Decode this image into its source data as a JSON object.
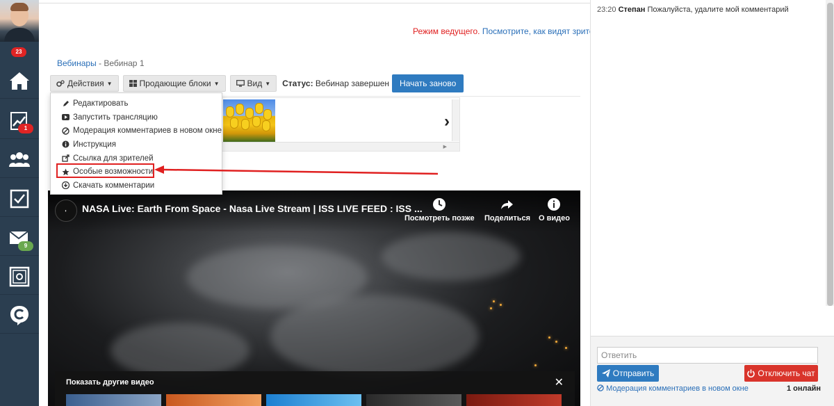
{
  "sidebar": {
    "avatar_badge": "23",
    "items": [
      {
        "name": "home-icon",
        "badge": ""
      },
      {
        "name": "chart-icon",
        "badge": "1"
      },
      {
        "name": "users-icon",
        "badge": ""
      },
      {
        "name": "checkbox-icon",
        "badge": ""
      },
      {
        "name": "mail-icon",
        "badge": "9"
      },
      {
        "name": "safe-icon",
        "badge": ""
      },
      {
        "name": "c-logo-icon",
        "badge": ""
      }
    ]
  },
  "header": {
    "host_mode_label": "Режим ведущего.",
    "viewer_link": "Посмотрите, как видят зрители"
  },
  "breadcrumb": {
    "parent": "Вебинары",
    "separator": " - ",
    "current": "Вебинар 1"
  },
  "toolbar": {
    "actions_label": "Действия",
    "selling_blocks_label": "Продающие блоки",
    "view_label": "Вид",
    "status_label": "Статус:",
    "status_value": "Вебинар завершен",
    "restart_label": "Начать заново"
  },
  "dropdown": {
    "items": [
      {
        "icon": "pencil-icon",
        "label": "Редактировать"
      },
      {
        "icon": "youtube-icon",
        "label": "Запустить трансляцию"
      },
      {
        "icon": "ban-icon",
        "label": "Модерация комментариев в новом окне"
      },
      {
        "icon": "info-icon",
        "label": "Инструкция"
      },
      {
        "icon": "external-link-icon",
        "label": "Ссылка для зрителей"
      },
      {
        "icon": "star-icon",
        "label": "Особые возможности"
      },
      {
        "icon": "download-icon",
        "label": "Скачать комментарии"
      }
    ],
    "highlighted_index": 5
  },
  "video": {
    "title": "NASA Live: Earth From Space - Nasa Live Stream | ISS LIVE FEED : ISS ...",
    "watch_later": "Посмотреть позже",
    "share": "Поделиться",
    "about": "О видео",
    "more_videos_title": "Показать другие видео"
  },
  "chat": {
    "messages": [
      {
        "time": "23:20",
        "user": "Степан",
        "text": "Пожалуйста, удалите мой комментарий"
      }
    ],
    "reply_placeholder": "Ответить",
    "send_label": "Отправить",
    "disable_chat_label": "Отключить чат",
    "moderation_link": "Модерация комментариев в новом окне",
    "online_count": "1 онлайн"
  },
  "colors": {
    "sidebar_bg": "#2b3e50",
    "primary_blue": "#2f7bc0",
    "danger_red": "#d9342b",
    "annotation_red": "#e02020",
    "link_blue": "#2a6fb8"
  }
}
